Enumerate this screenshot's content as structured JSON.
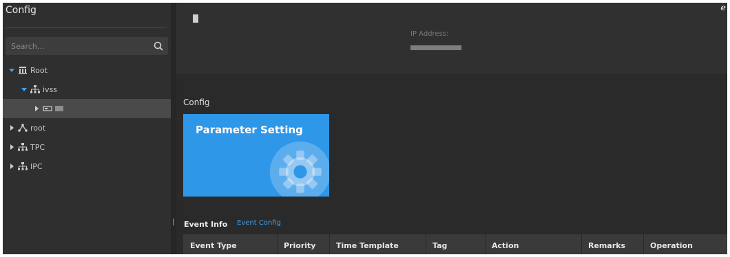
{
  "sidebar": {
    "title": "Config",
    "search": {
      "placeholder": "Search..."
    },
    "tree": [
      {
        "label": "Root",
        "expanded": true,
        "level": 0,
        "icon": "organization-icon"
      },
      {
        "label": "ivss",
        "expanded": true,
        "level": 1,
        "icon": "network-icon"
      },
      {
        "label": "",
        "expanded": false,
        "level": 2,
        "icon": "device-icon",
        "selected": true
      },
      {
        "label": "root",
        "expanded": false,
        "level": 1,
        "icon": "hierarchy-icon"
      },
      {
        "label": "TPC",
        "expanded": false,
        "level": 1,
        "icon": "network-icon"
      },
      {
        "label": "IPC",
        "expanded": false,
        "level": 1,
        "icon": "network-icon"
      }
    ]
  },
  "header": {
    "ip_label": "IP Address:"
  },
  "main": {
    "section_label": "Config",
    "card": {
      "title": "Parameter Setting",
      "icon": "gear-icon"
    },
    "event": {
      "label": "Event Info",
      "config_link": "Event Config",
      "columns": [
        "Event Type",
        "Priority",
        "Time Template",
        "Tag",
        "Action",
        "Remarks",
        "Operation"
      ]
    }
  },
  "colors": {
    "accent": "#2f97e8",
    "link": "#3aa0f0",
    "background": "#2b2b2b",
    "tree_caret": "#3aa0f0"
  }
}
